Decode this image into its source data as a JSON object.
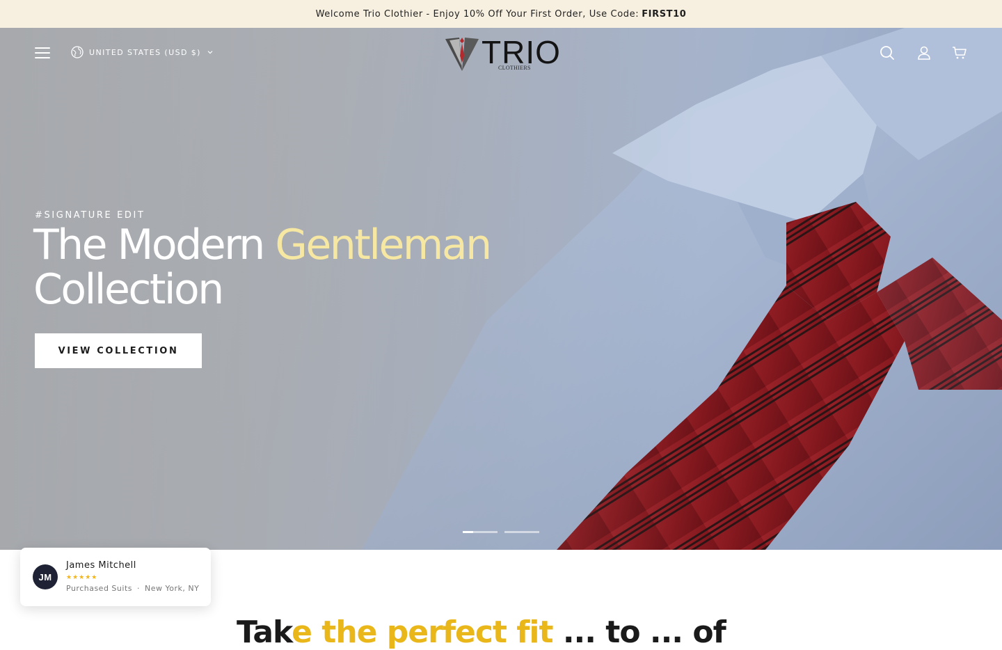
{
  "announcement": {
    "text": "Welcome Trio Clothier - Enjoy 10% Off Your First Order, Use Code:",
    "code": "FIRST10"
  },
  "header": {
    "menu_icon": "hamburger-menu-icon",
    "locale_icon": "globe-icon",
    "locale_label": "UNITED STATES (USD $)",
    "locale_chevron": "chevron-down-icon",
    "logo_text": "TRIO",
    "logo_subtext": "CLOTHIERS",
    "icons": [
      "search-icon",
      "account-icon",
      "cart-icon"
    ]
  },
  "hero": {
    "eyebrow": "#SIGNATURE EDIT",
    "headline_part1": "The Modern",
    "headline_accent": "Gentleman",
    "headline_part2": "Collection",
    "cta_label": "VIEW COLLECTION",
    "slide_count": 2,
    "active_slide": 1,
    "active_slide_progress": 0.3
  },
  "social_proof": {
    "initials": "JM",
    "name": "James Mitchell",
    "stars": "★★★★★",
    "rating": 5,
    "purchase": "Purchased Suits",
    "separator": "·",
    "location": "New York, NY"
  },
  "next_section": {
    "heading_start": "Tak",
    "heading_accent": "e the perfect fit",
    "heading_end": " ... to ... of"
  },
  "colors": {
    "announcement_bg": "#f7f0e0",
    "accent_gold": "#f6e7a2",
    "tie_red": "#8c1f24",
    "shirt_blue": "#a1b1cc"
  }
}
